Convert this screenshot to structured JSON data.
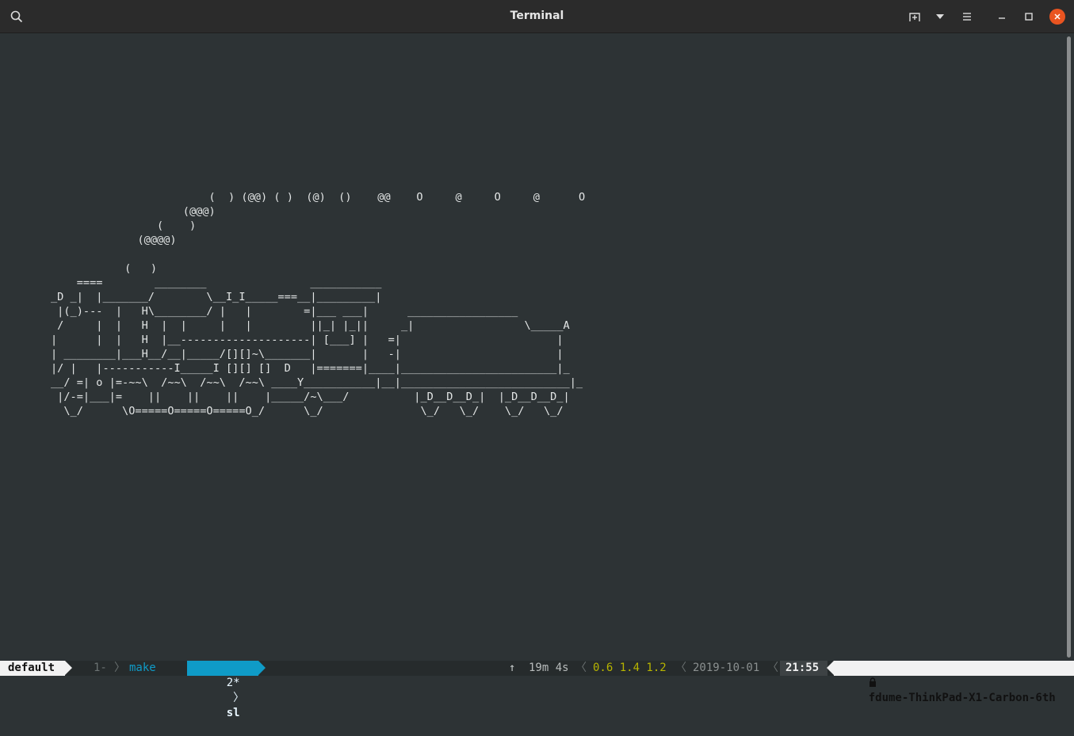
{
  "window": {
    "title": "Terminal",
    "buttons": [
      "search-icon",
      "new-tab-icon",
      "dropdown-icon",
      "menu-icon",
      "minimize-icon",
      "maximize-icon",
      "close-icon"
    ],
    "accent": "#e95420"
  },
  "terminal": {
    "background": "#2d3335",
    "smoke": "                   (  ) (@@) ( )  (@)  ()    @@    O     @     O     @      O\n               (@@@)\n           (    )\n        (@@@@)\n\n      (   )",
    "train": "    ====        ________                ___________\n_D _|  |_______/        \\__I_I_____===__|_________|\n |(_)---  |   H\\________/ |   |        =|___ ___|      _________________\n /     |  |   H  |  |     |   |         ||_| |_||     _|                 \\_____A\n|      |  |   H  |__--------------------| [___] |   =|                        |\n| ________|___H__/__|_____/[][]~\\_______|       |   -|                        |\n|/ |   |-----------I_____I [][] []  D   |=======|____|________________________|_\n__/ =| o |=-~~\\  /~~\\  /~~\\  /~~\\ ____Y___________|__|__________________________|_\n |/-=|___|=    ||    ||    ||    |_____/~\\___/          |_D__D__D_|  |_D__D__D_|\n  \\_/      \\O=====O=====O=====O_/      \\_/               \\_/   \\_/    \\_/   \\_/"
  },
  "statusbar": {
    "session": "default",
    "window_1": "1-",
    "window_1_name": "make",
    "window_2": "2*",
    "window_2_name": "sl",
    "uptime_arrow": "↑",
    "uptime": "19m 4s",
    "load": "0.6 1.4 1.2",
    "date": "2019-10-01",
    "time": "21:55",
    "host": "fdume-ThinkPad-X1-Carbon-6th"
  }
}
